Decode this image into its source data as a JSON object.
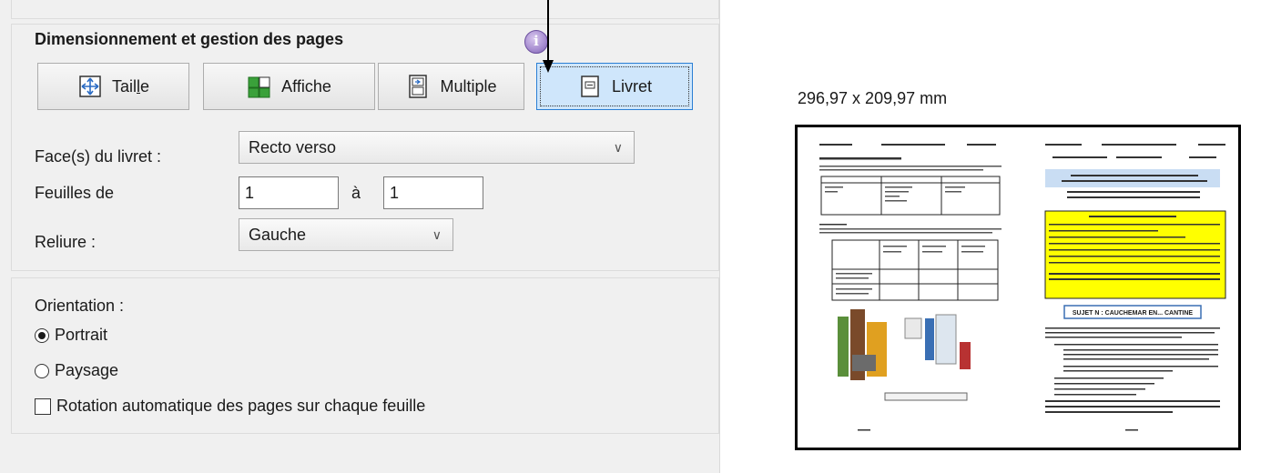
{
  "section": {
    "title": "Dimensionnement et gestion des pages",
    "info_icon": "info-icon"
  },
  "mode_buttons": [
    {
      "label_pre": "Tail",
      "label_ul": "l",
      "label_post": "e",
      "icon": "resize-icon",
      "selected": false
    },
    {
      "label": "Affiche",
      "icon": "poster-icon",
      "selected": false
    },
    {
      "label": "Multiple",
      "icon": "multiple-pages-icon",
      "selected": false
    },
    {
      "label": "Livret",
      "icon": "booklet-icon",
      "selected": true
    }
  ],
  "form": {
    "faces_label": "Face(s) du livret :",
    "faces_value": "Recto verso",
    "sheets_label": "Feuilles de",
    "sheets_from": "1",
    "sheets_to_label": "à",
    "sheets_to": "1",
    "binding_label": "Reliure :",
    "binding_value": "Gauche"
  },
  "orientation": {
    "label": "Orientation :",
    "portrait": "Portrait",
    "landscape": "Paysage",
    "selected": "portrait",
    "auto_rotate": "Rotation automatique des pages sur chaque feuille",
    "auto_rotate_checked": false
  },
  "preview": {
    "dimensions": "296,97 x 209,97 mm",
    "left_page": {
      "boxed_text": "",
      "page_label": ""
    },
    "right_page": {
      "title_box": "SUJET N : CAUCHEMAR EN... CANTINE"
    }
  },
  "colors": {
    "accent_selected": "#2a7fd4",
    "selected_bg": "#cfe6fb",
    "highlight_yellow": "#ffff00",
    "light_blue_band": "#c9ddf3"
  }
}
